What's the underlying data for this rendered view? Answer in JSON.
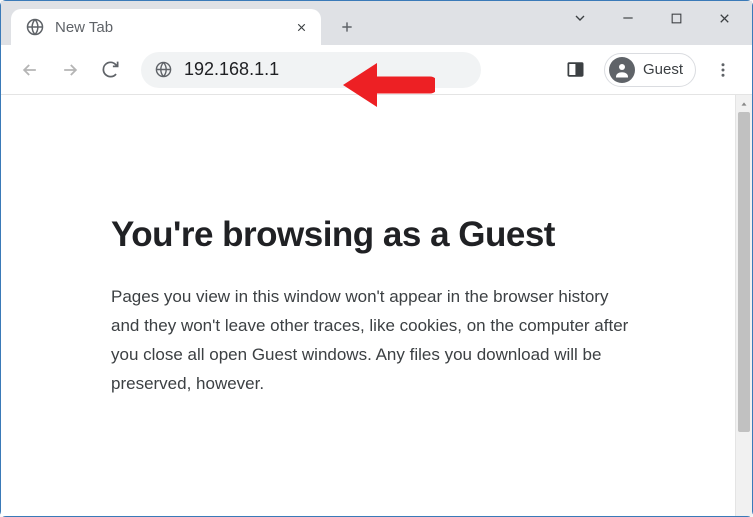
{
  "tab": {
    "title": "New Tab"
  },
  "omnibox": {
    "value": "192.168.1.1"
  },
  "profile": {
    "label": "Guest"
  },
  "page": {
    "heading": "You're browsing as a Guest",
    "body": "Pages you view in this window won't appear in the browser history and they won't leave other traces, like cookies, on the computer after you close all open Guest windows. Any files you download will be preserved, however."
  }
}
